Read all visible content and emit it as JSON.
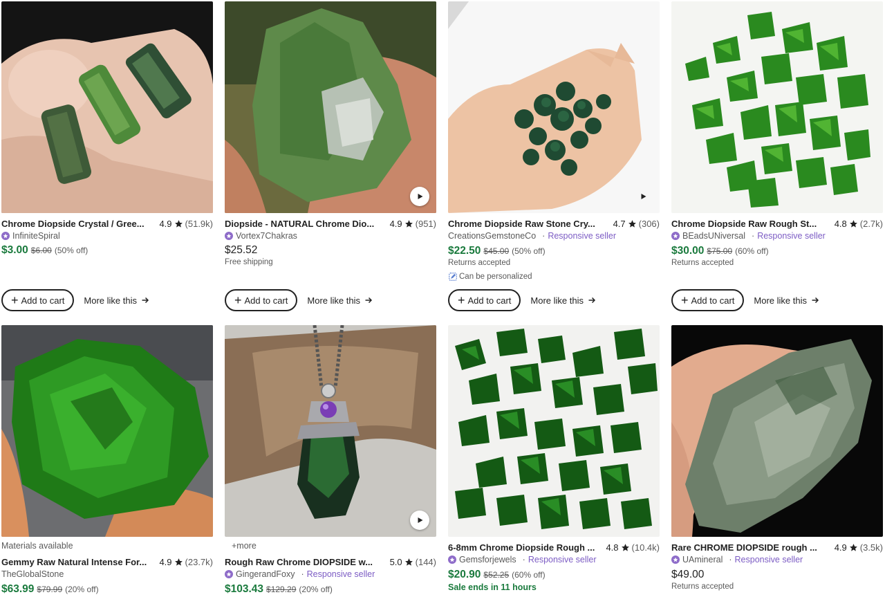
{
  "listings": [
    {
      "title": "Chrome Diopside Crystal / Gree...",
      "rating": "4.9",
      "reviews": "(51.9k)",
      "shop": "InfiniteSpiral",
      "price": "$3.00",
      "original_price": "$6.00",
      "discount": "(50% off)",
      "add_to_cart": "Add to cart",
      "more_like_this": "More like this"
    },
    {
      "title": "Diopside - NATURAL Chrome Dio...",
      "rating": "4.9",
      "reviews": "(951)",
      "shop": "Vortex7Chakras",
      "price": "$25.52",
      "note": "Free shipping",
      "add_to_cart": "Add to cart",
      "more_like_this": "More like this"
    },
    {
      "title": "Chrome Diopside Raw Stone Cry...",
      "rating": "4.7",
      "reviews": "(306)",
      "shop": "CreationsGemstoneCo",
      "responsive": "Responsive seller",
      "price": "$22.50",
      "original_price": "$45.00",
      "discount": "(50% off)",
      "note": "Returns accepted",
      "personalized": "Can be personalized",
      "add_to_cart": "Add to cart",
      "more_like_this": "More like this"
    },
    {
      "title": "Chrome Diopside Raw Rough St...",
      "rating": "4.8",
      "reviews": "(2.7k)",
      "shop": "BEadsUNiversal",
      "responsive": "Responsive seller",
      "price": "$30.00",
      "original_price": "$75.00",
      "discount": "(60% off)",
      "note": "Returns accepted",
      "add_to_cart": "Add to cart",
      "more_like_this": "More like this"
    },
    {
      "top_note": "Materials available",
      "title": "Gemmy Raw Natural Intense For...",
      "rating": "4.9",
      "reviews": "(23.7k)",
      "shop": "TheGlobalStone",
      "price": "$63.99",
      "original_price": "$79.99",
      "discount": "(20% off)"
    },
    {
      "top_note": "+more",
      "title": "Rough Raw Chrome DIOPSIDE w...",
      "rating": "5.0",
      "reviews": "(144)",
      "shop": "GingerandFoxy",
      "responsive": "Responsive seller",
      "price": "$103.43",
      "original_price": "$129.29",
      "discount": "(20% off)"
    },
    {
      "title": "6-8mm Chrome Diopside Rough ...",
      "rating": "4.8",
      "reviews": "(10.4k)",
      "shop": "Gemsforjewels",
      "responsive": "Responsive seller",
      "price": "$20.90",
      "original_price": "$52.25",
      "discount": "(60% off)",
      "sale": "Sale ends in 11 hours"
    },
    {
      "title": "Rare CHROME DIOPSIDE rough ...",
      "rating": "4.9",
      "reviews": "(3.5k)",
      "shop": "UAmineral",
      "responsive": "Responsive seller",
      "price": "$49.00",
      "note": "Returns accepted"
    }
  ],
  "colors": {
    "sale_price": "#1a7a3d",
    "responsive": "#7c5cc4",
    "badge": "#8e6cc9"
  },
  "icons": {
    "star": "star-icon",
    "play": "play-icon",
    "arrow": "arrow-right-icon",
    "plus": "plus-icon",
    "badge": "star-seller-badge-icon"
  }
}
